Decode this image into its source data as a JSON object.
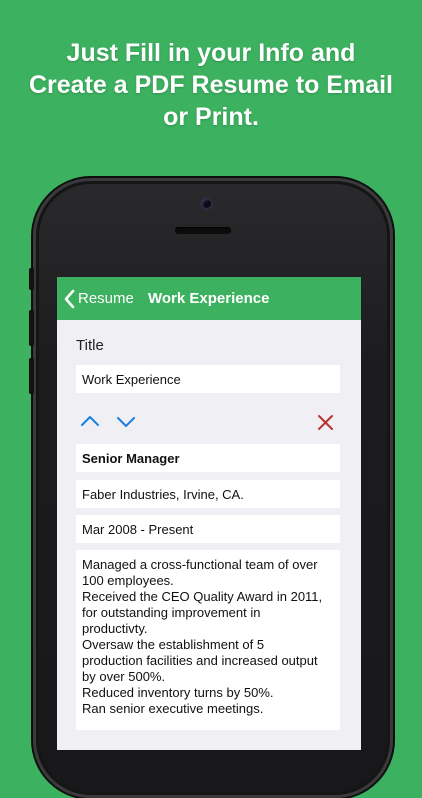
{
  "headline": {
    "line1": "Just Fill in your Info and",
    "line2": "Create a PDF Resume to Email",
    "line3": "or Print."
  },
  "colors": {
    "brand_green": "#3cb160",
    "screen_bg": "#efeff4",
    "arrow_blue": "#1a7fe0",
    "delete_red": "#b8352f"
  },
  "nav": {
    "back_label": "Resume",
    "title": "Work Experience"
  },
  "form": {
    "section_label": "Title",
    "title_value": "Work Experience",
    "entry": {
      "position": "Senior Manager",
      "company": "Faber Industries, Irvine, CA.",
      "dates": "Mar 2008 - Present",
      "description": "Managed a cross-functional team of over\n100 employees.\nReceived the CEO Quality Award in 2011,\nfor outstanding improvement in\nproductivty.\nOversaw the establishment of 5\nproduction facilities and increased output\nby over 500%.\nReduced inventory turns by 50%.\nRan senior executive meetings."
    }
  },
  "icons": {
    "back": "chevron-left-icon",
    "move_up": "chevron-up-icon",
    "move_down": "chevron-down-icon",
    "delete": "close-icon"
  }
}
